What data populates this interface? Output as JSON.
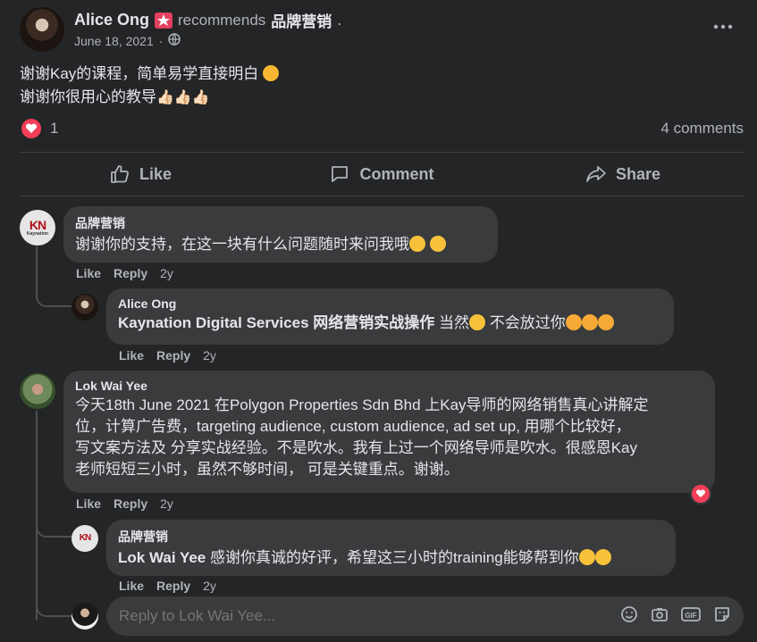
{
  "post": {
    "author": "Alice Ong",
    "badge_icon": "star-badge-icon",
    "recommends_text": "recommends",
    "page_name": "品牌营销",
    "period": ".",
    "date": "June 18, 2021",
    "privacy_icon": "globe-icon",
    "body_line1": "谢谢Kay的课程，简单易学直接明白",
    "body_line2": "谢谢你很用心的教导",
    "reaction_count": "1",
    "comments_count": "4 comments",
    "more_icon": "more-options-icon"
  },
  "actions": {
    "like": "Like",
    "comment": "Comment",
    "share": "Share"
  },
  "comments": [
    {
      "name": "品牌营销",
      "text": "谢谢你的支持，在这一块有什么问题随时来问我哦",
      "like": "Like",
      "reply": "Reply",
      "time": "2y"
    },
    {
      "name": "Alice Ong",
      "tag": "Kaynation Digital Services 网络营销实战操作",
      "text_a": " 当然",
      "text_b": " 不会放过你",
      "like": "Like",
      "reply": "Reply",
      "time": "2y"
    },
    {
      "name": "Lok Wai Yee",
      "line1": "今天18th June 2021 在Polygon Properties Sdn Bhd 上Kay导师的网络销售真心讲解定",
      "line2": "位，计算广告费，targeting audience, custom audience, ad set up, 用哪个比较好，",
      "line3": "写文案方法及 分享实战经验。不是吹水。我有上过一个网络导师是吹水。很感恩Kay",
      "line4": "老师短短三小时，虽然不够时间， 可是关键重点。谢谢。",
      "like": "Like",
      "reply": "Reply",
      "time": "2y"
    },
    {
      "name": "品牌营销",
      "tag": "Lok Wai Yee",
      "text": " 感谢你真诚的好评，希望这三小时的training能够帮到你",
      "like": "Like",
      "reply": "Reply",
      "time": "2y"
    }
  ],
  "reply_input": {
    "placeholder": "Reply to Lok Wai Yee..."
  },
  "brand_logo_text": "Kaynation",
  "colors": {
    "background": "#242526",
    "bubble": "#3a3b3c",
    "text": "#e4e6eb",
    "muted": "#b0b3b8",
    "reaction": "#f33e58"
  }
}
